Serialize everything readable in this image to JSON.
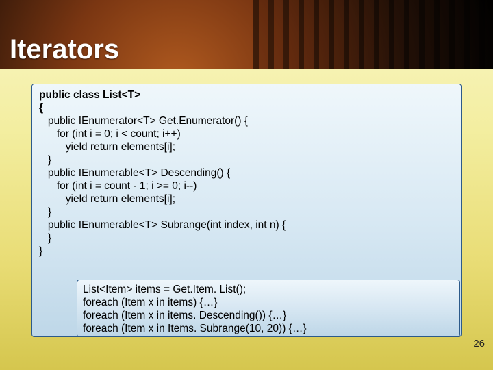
{
  "title": "Iterators",
  "page_number": "26",
  "code": {
    "l1": "public class List<T>",
    "l2": "{",
    "l3_a": "   public IEnumerator<T> Get.",
    "l3_b": "Enumerator() {",
    "l4": "      for (int i = 0; i < count; i++)",
    "l5": "         yield return elements[i];",
    "l6": "   }",
    "l7": "",
    "l8": "   public IEnumerable<T> Descending() {",
    "l9": "      for (int i = count - 1; i >= 0; i--)",
    "l10": "         yield return elements[i];",
    "l11": "   }",
    "l12": "",
    "l13": "   public IEnumerable<T> Subrange(int index, int n) {",
    "l14": "",
    "l15": "",
    "l16": "   }",
    "l17": "}"
  },
  "inner": {
    "l1_a": "List<Item> items = Get.",
    "l1_b": "Item. ",
    "l1_c": "List();",
    "l2": "foreach (Item x in items) {…}",
    "l3": "foreach (Item x in items. Descending()) {…}",
    "l4": "foreach (Item x in Items. Subrange(10, 20)) {…}"
  }
}
